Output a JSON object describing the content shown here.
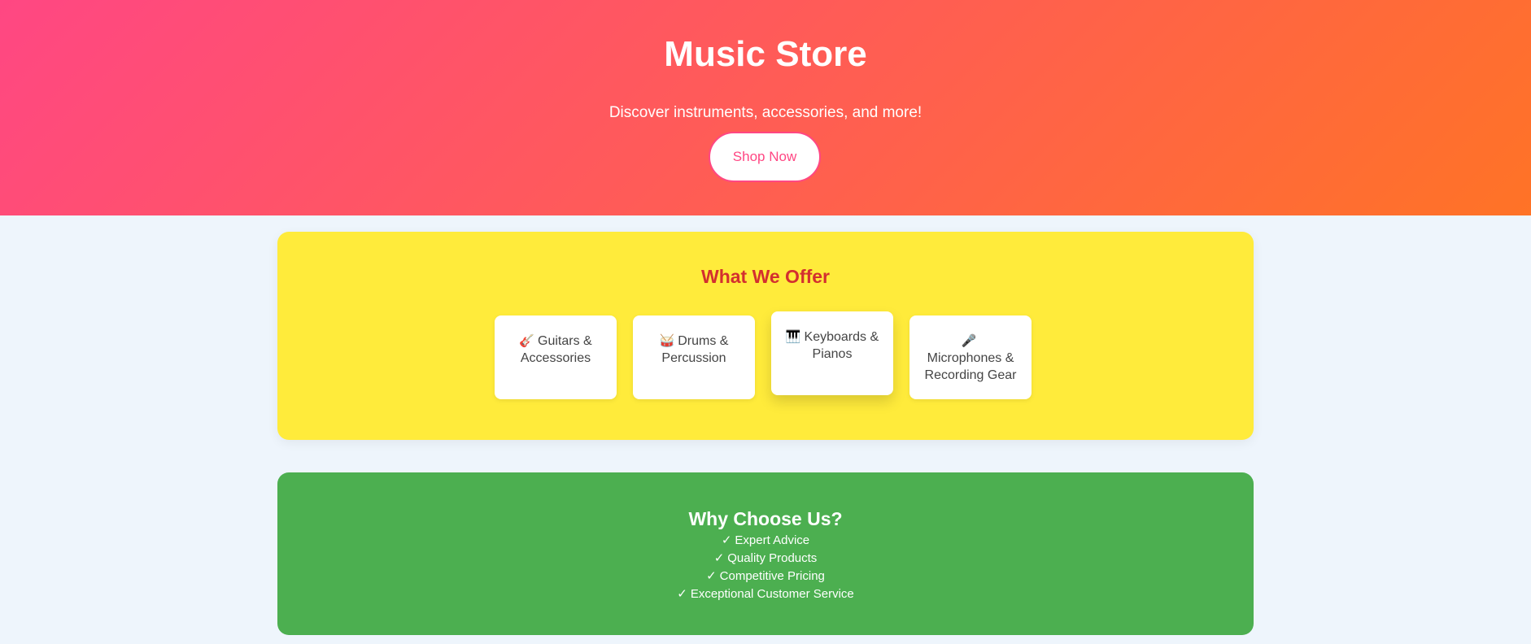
{
  "hero": {
    "title": "Music Store",
    "subtitle": "Discover instruments, accessories, and more!",
    "button_label": "Shop Now"
  },
  "offer": {
    "title": "What We Offer",
    "cards": [
      {
        "icon": "🎸",
        "icon_name": "guitar-icon",
        "label": "Guitars & Accessories"
      },
      {
        "icon": "🥁",
        "icon_name": "drum-icon",
        "label": "Drums & Percussion"
      },
      {
        "icon": "🎹",
        "icon_name": "keyboard-icon",
        "label": "Keyboards & Pianos"
      },
      {
        "icon": "🎤",
        "icon_name": "microphone-icon",
        "label": "Microphones & Recording Gear"
      }
    ]
  },
  "why": {
    "title": "Why Choose Us?",
    "check": "✓",
    "items": [
      "Expert Advice",
      "Quality Products",
      "Competitive Pricing",
      "Exceptional Customer Service"
    ]
  },
  "colors": {
    "hero_gradient_start": "#ff4783",
    "hero_gradient_end": "#ff7326",
    "offer_background": "#ffeb3b",
    "offer_title": "#d32f2f",
    "why_background": "#4caf50",
    "page_background": "#eef5fc"
  }
}
